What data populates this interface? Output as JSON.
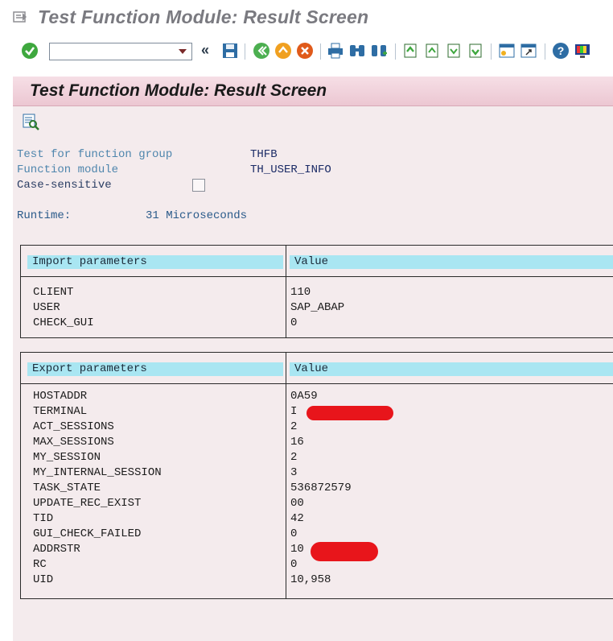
{
  "window": {
    "title": "Test Function Module: Result Screen"
  },
  "toolbar": {
    "command_field_value": "",
    "back_label": "«"
  },
  "screen": {
    "title": "Test Function Module: Result Screen"
  },
  "info": {
    "function_group_label": "Test for function group",
    "function_group_value": "THFB",
    "function_module_label": "Function module",
    "function_module_value": "TH_USER_INFO",
    "case_sensitive_label": "Case-sensitive",
    "case_sensitive_checked": false,
    "runtime_label": "Runtime:",
    "runtime_value": "31 Microseconds"
  },
  "import_panel": {
    "header_name": "Import parameters",
    "header_value": "Value",
    "rows": [
      {
        "name": "CLIENT",
        "value": "110"
      },
      {
        "name": "USER",
        "value": "SAP_ABAP"
      },
      {
        "name": "CHECK_GUI",
        "value": "0"
      }
    ]
  },
  "export_panel": {
    "header_name": "Export parameters",
    "header_value": "Value",
    "rows": [
      {
        "name": "HOSTADDR",
        "value": "0A59"
      },
      {
        "name": "TERMINAL",
        "value": "I"
      },
      {
        "name": "ACT_SESSIONS",
        "value": "2"
      },
      {
        "name": "MAX_SESSIONS",
        "value": "16"
      },
      {
        "name": "MY_SESSION",
        "value": "2"
      },
      {
        "name": "MY_INTERNAL_SESSION",
        "value": "3"
      },
      {
        "name": "TASK_STATE",
        "value": "536872579"
      },
      {
        "name": "UPDATE_REC_EXIST",
        "value": "00"
      },
      {
        "name": "TID",
        "value": "42"
      },
      {
        "name": "GUI_CHECK_FAILED",
        "value": "0"
      },
      {
        "name": "ADDRSTR",
        "value": "10"
      },
      {
        "name": "RC",
        "value": "0"
      },
      {
        "name": "UID",
        "value": "10,958"
      }
    ]
  },
  "colors": {
    "label_blue": "#4f86ad",
    "value_navy": "#1b2b66",
    "header_cyan": "#a9e6f2",
    "redaction_red": "#e8151b"
  }
}
